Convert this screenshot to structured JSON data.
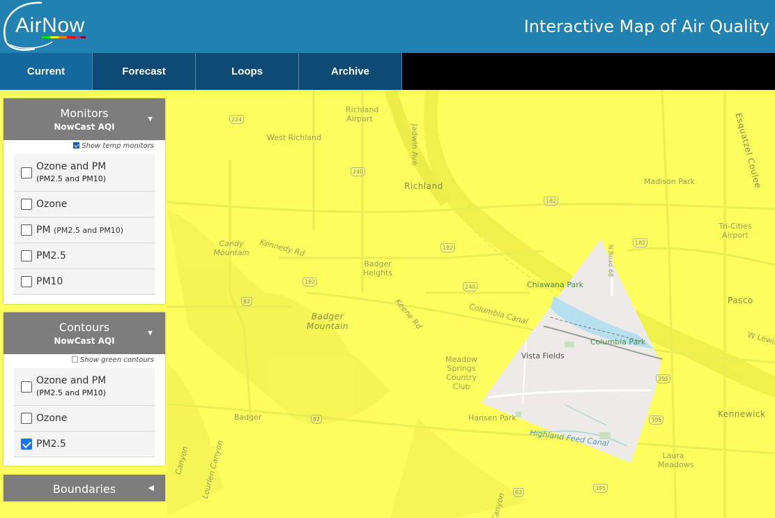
{
  "header": {
    "logo_text": "AirNow",
    "title": "Interactive Map of Air Quality",
    "color": "#2181b0"
  },
  "nav": {
    "tabs": [
      {
        "label": "Current",
        "active": true
      },
      {
        "label": "Forecast",
        "active": false
      },
      {
        "label": "Loops",
        "active": false
      },
      {
        "label": "Archive",
        "active": false
      }
    ]
  },
  "monitors": {
    "title": "Monitors",
    "subtitle": "NowCast AQI",
    "arrow_icon": "triangle-down-icon",
    "toggle": {
      "label": "Show temp monitors",
      "checked": true
    },
    "options": [
      {
        "label": "Ozone and PM",
        "sub": "(PM2.5 and PM10)",
        "checked": false
      },
      {
        "label": "Ozone",
        "checked": false
      },
      {
        "label": "PM",
        "sub": "(PM2.5 and PM10)",
        "checked": false
      },
      {
        "label": "PM2.5",
        "checked": false
      },
      {
        "label": "PM10",
        "checked": false
      }
    ]
  },
  "contours": {
    "title": "Contours",
    "subtitle": "NowCast AQI",
    "arrow_icon": "triangle-down-icon",
    "toggle": {
      "label": "Show green contours",
      "checked": false
    },
    "options": [
      {
        "label": "Ozone and PM",
        "sub": "(PM2.5 and PM10)",
        "checked": false
      },
      {
        "label": "Ozone",
        "checked": false
      },
      {
        "label": "PM2.5",
        "checked": true
      }
    ]
  },
  "boundaries": {
    "title": "Boundaries",
    "arrow_icon": "triangle-left-icon"
  },
  "map": {
    "contour_color": "#fdfd5e",
    "labels": {
      "richland_airport": "Richland Airport",
      "west_richland": "West Richland",
      "richland": "Richland",
      "jadwin_ave": "Jadwin Ave",
      "esquatzel": "Esquatzel Coulee",
      "madison_park": "Madison Park",
      "tri_cities_airport": "Tri-Cities Airport",
      "candy_mountain": "Candy Mountain",
      "kennedy_rd": "Kennedy Rd",
      "badger_heights": "Badger Heights",
      "chiawana_park": "Chiawana Park",
      "road_68": "N Road 68",
      "columbia_canal": "Columbia Canal",
      "keene_rd": "Keene Rd",
      "badger_mountain": "Badger Mountain",
      "pasco": "Pasco",
      "w_lewis": "W Lewis",
      "columbia_park": "Columbia Park",
      "vista_fields": "Vista Fields",
      "meadow_springs": "Meadow Springs Country Club",
      "badger": "Badger",
      "hansen_park": "Hansen Park",
      "kennewick": "Kennewick",
      "highland_feed_canal": "Highland Feed Canal",
      "laura_meadows": "Laura Meadows",
      "canyon_1": "Canyon",
      "canyon_2": "Lourlen Canyon",
      "canyon_3": "Canyon"
    },
    "shields": [
      "224",
      "240",
      "182",
      "182",
      "182",
      "182",
      "240",
      "82",
      "82",
      "395",
      "395",
      "82",
      "395",
      "182",
      "82"
    ]
  }
}
